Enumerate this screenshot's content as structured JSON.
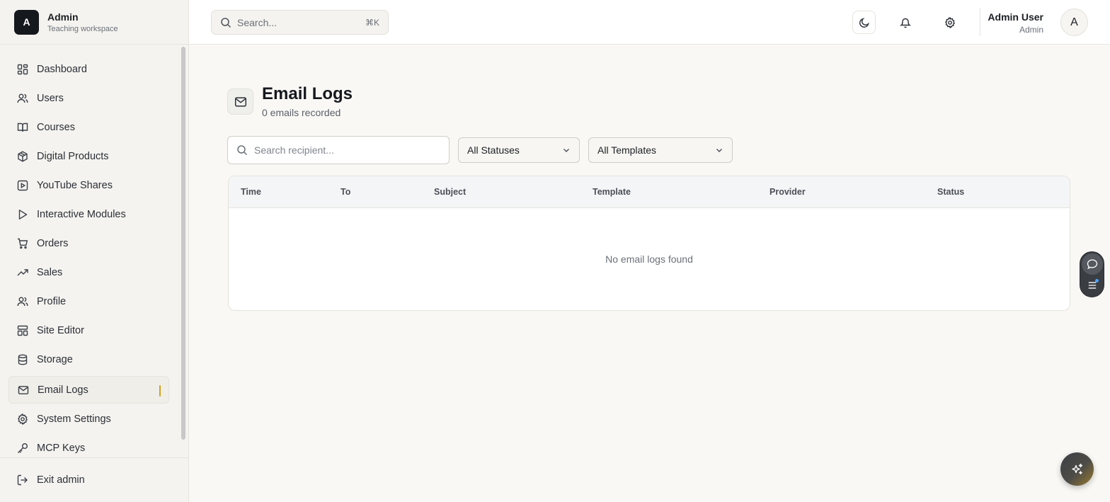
{
  "brand": {
    "mark": "A",
    "title": "Admin",
    "subtitle": "Teaching workspace"
  },
  "sidebar": {
    "items": [
      {
        "label": "Dashboard",
        "icon": "dashboard-icon"
      },
      {
        "label": "Users",
        "icon": "users-icon"
      },
      {
        "label": "Courses",
        "icon": "book-icon"
      },
      {
        "label": "Digital Products",
        "icon": "package-icon"
      },
      {
        "label": "YouTube Shares",
        "icon": "video-icon"
      },
      {
        "label": "Interactive Modules",
        "icon": "play-icon"
      },
      {
        "label": "Orders",
        "icon": "cart-icon"
      },
      {
        "label": "Sales",
        "icon": "trending-up-icon"
      },
      {
        "label": "Profile",
        "icon": "users-icon"
      },
      {
        "label": "Site Editor",
        "icon": "layout-icon"
      },
      {
        "label": "Storage",
        "icon": "database-icon"
      },
      {
        "label": "Email Logs",
        "icon": "mail-icon",
        "active": true
      },
      {
        "label": "System Settings",
        "icon": "gear-icon"
      },
      {
        "label": "MCP Keys",
        "icon": "key-icon"
      }
    ],
    "footer": {
      "label": "Exit admin",
      "icon": "logout-icon"
    }
  },
  "header": {
    "search": {
      "placeholder": "Search...",
      "shortcut": "⌘K"
    },
    "user": {
      "name": "Admin User",
      "role": "Admin",
      "avatar_initial": "A"
    }
  },
  "main": {
    "title": "Email Logs",
    "subtitle": "0 emails recorded",
    "filters": {
      "search_placeholder": "Search recipient...",
      "status": "All Statuses",
      "template": "All Templates"
    },
    "table": {
      "columns": [
        "Time",
        "To",
        "Subject",
        "Template",
        "Provider",
        "Status"
      ],
      "rows": [],
      "empty_message": "No email logs found"
    }
  },
  "colors": {
    "accent": "#d4a21a",
    "brand_dark": "#15181d",
    "background": "#f9f8f5"
  }
}
